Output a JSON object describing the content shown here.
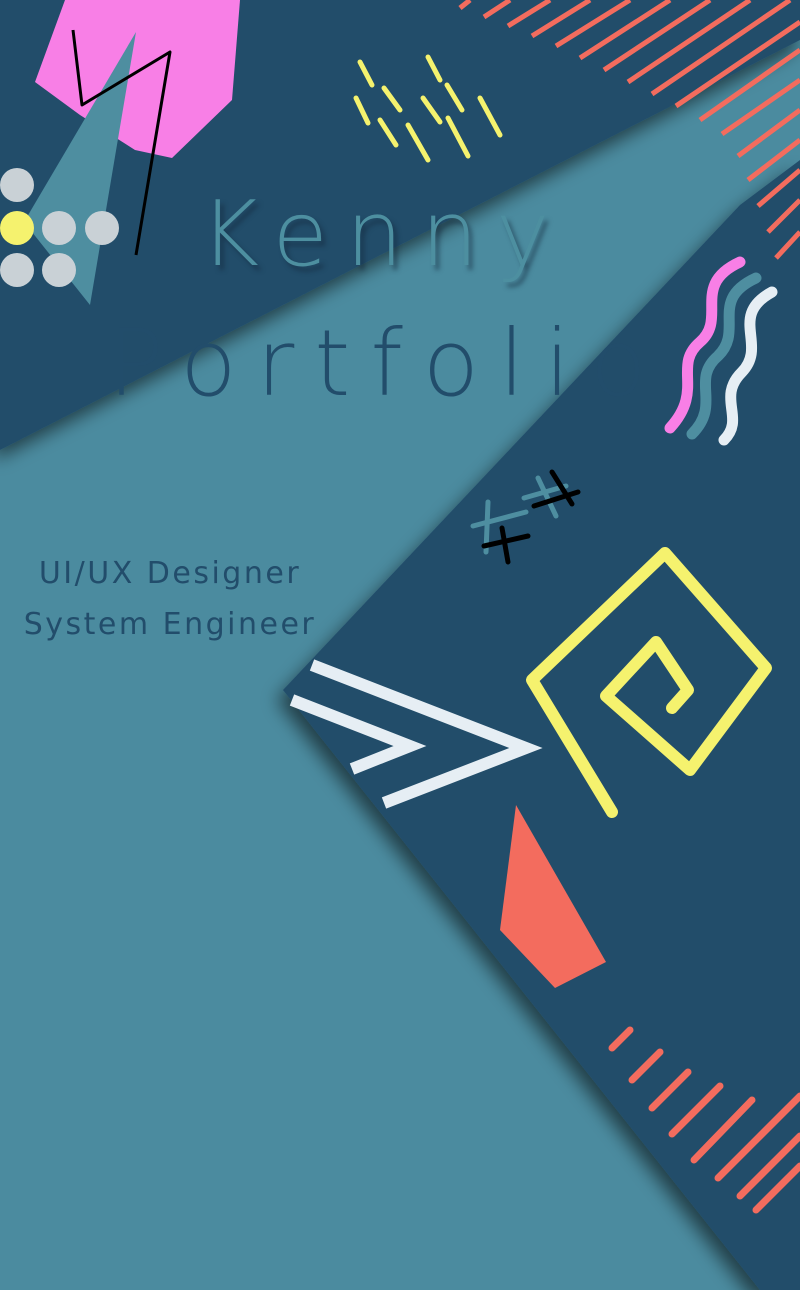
{
  "header": {
    "title_line1": "Kenny",
    "title_line2": "Portfolio"
  },
  "roles": {
    "role1": "UI/UX Designer",
    "role2": "System Engineer"
  },
  "colors": {
    "teal_light": "#4b8b9f",
    "navy": "#224d6b",
    "pink": "#f87fe6",
    "coral": "#f36c5e",
    "yellow": "#f5f26e",
    "off_white": "#e6eef4",
    "grey_dot": "#c9d1d6"
  },
  "decorations": {
    "shapes": [
      "pink-hexagon",
      "zigzag-scribble",
      "teal-triangle",
      "dot-grid",
      "yellow-dashes",
      "coral-stripes",
      "wavy-lines",
      "cross-marks",
      "chevron-arrow",
      "yellow-spiral",
      "coral-quad",
      "coral-bars"
    ]
  }
}
